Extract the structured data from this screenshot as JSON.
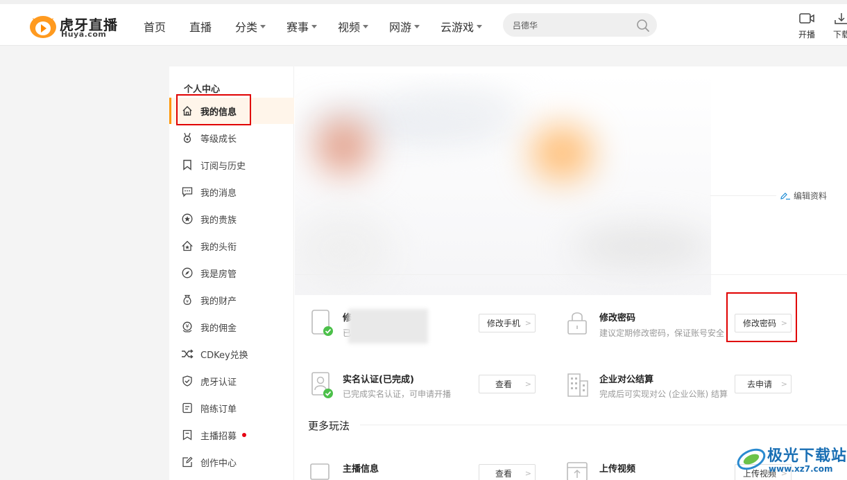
{
  "header": {
    "logo_cn": "虎牙直播",
    "logo_en": "Huya.com",
    "nav": [
      {
        "label": "首页",
        "dropdown": false
      },
      {
        "label": "直播",
        "dropdown": false
      },
      {
        "label": "分类",
        "dropdown": true
      },
      {
        "label": "赛事",
        "dropdown": true
      },
      {
        "label": "视频",
        "dropdown": true
      },
      {
        "label": "网游",
        "dropdown": true
      },
      {
        "label": "云游戏",
        "dropdown": true
      }
    ],
    "search": {
      "value": "吕德华",
      "icon": "search-icon"
    },
    "tools": [
      {
        "label": "开播",
        "icon": "camera-icon"
      },
      {
        "label": "下载",
        "icon": "download-icon"
      }
    ]
  },
  "sidebar": {
    "title": "个人中心",
    "items": [
      {
        "label": "我的信息",
        "icon": "home-icon",
        "active": true
      },
      {
        "label": "等级成长",
        "icon": "medal-icon"
      },
      {
        "label": "订阅与历史",
        "icon": "bookmark-icon"
      },
      {
        "label": "我的消息",
        "icon": "message-icon"
      },
      {
        "label": "我的贵族",
        "icon": "star-icon"
      },
      {
        "label": "我的头衔",
        "icon": "house-badge-icon"
      },
      {
        "label": "我是房管",
        "icon": "compass-icon"
      },
      {
        "label": "我的财产",
        "icon": "money-bag-icon"
      },
      {
        "label": "我的佣金",
        "icon": "yen-coin-icon"
      },
      {
        "label": "CDKey兑换",
        "icon": "shuffle-icon"
      },
      {
        "label": "虎牙认证",
        "icon": "shield-check-icon"
      },
      {
        "label": "陪练订单",
        "icon": "order-icon"
      },
      {
        "label": "主播招募",
        "icon": "flag-icon",
        "badge": true
      },
      {
        "label": "创作中心",
        "icon": "edit-icon"
      }
    ]
  },
  "profile": {
    "edit_label": "编辑资料"
  },
  "security": {
    "phone": {
      "title": "修",
      "desc": "已",
      "button": "修改手机"
    },
    "password": {
      "title": "修改密码",
      "desc": "建议定期修改密码，保证账号安全",
      "button": "修改密码"
    },
    "realname": {
      "title": "实名认证(已完成)",
      "desc": "已完成实名认证，可申请开播",
      "button": "查看"
    },
    "enterprise": {
      "title": "企业对公结算",
      "desc": "完成后可实现对公 (企业公账) 结算",
      "button": "去申请"
    }
  },
  "more": {
    "title": "更多玩法",
    "items": [
      {
        "title": "主播信息",
        "button": "查看"
      },
      {
        "title": "上传视频",
        "button": "上传视频"
      }
    ]
  },
  "watermark": {
    "cn": "极光下载站",
    "en": "www.xz7.com"
  },
  "colors": {
    "accent": "#ff9600",
    "highlight": "#e00000",
    "active_bg": "#fff5ea",
    "watermark": "#1a6fb4"
  }
}
